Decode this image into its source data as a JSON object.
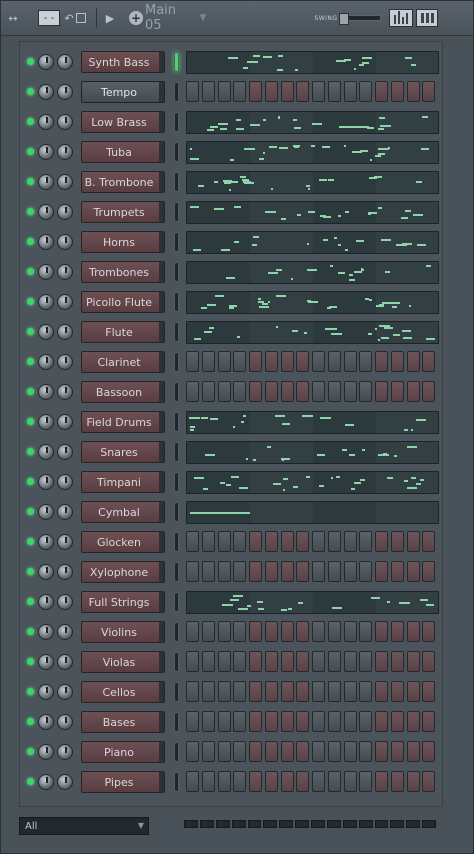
{
  "toolbar": {
    "pattern_name": "Main 05",
    "swing_label": "SWING",
    "swing_value": 0.0,
    "icons": [
      "arrows-icon",
      "minus-icon",
      "undo-icon",
      "box-icon",
      "play-icon",
      "plus-icon",
      "graph-editor-icon",
      "keyboard-editor-icon"
    ]
  },
  "colors": {
    "led_on": "#3bd36b",
    "note": "#8fd4a8",
    "step_red": "#6d5559",
    "step_gray": "#5b6368"
  },
  "channels": [
    {
      "name": "Synth Bass",
      "mode": "roll",
      "selected": true
    },
    {
      "name": "Tempo",
      "mode": "steps",
      "name_style": "gray"
    },
    {
      "name": "Low Brass",
      "mode": "roll"
    },
    {
      "name": "Tuba",
      "mode": "roll"
    },
    {
      "name": "B. Trombone",
      "mode": "roll"
    },
    {
      "name": "Trumpets",
      "mode": "roll"
    },
    {
      "name": "Horns",
      "mode": "roll"
    },
    {
      "name": "Trombones",
      "mode": "roll"
    },
    {
      "name": "Picollo Flute",
      "mode": "roll"
    },
    {
      "name": "Flute",
      "mode": "roll"
    },
    {
      "name": "Clarinet",
      "mode": "steps"
    },
    {
      "name": "Bassoon",
      "mode": "steps"
    },
    {
      "name": "Field Drums",
      "mode": "roll"
    },
    {
      "name": "Snares",
      "mode": "roll"
    },
    {
      "name": "Timpani",
      "mode": "roll"
    },
    {
      "name": "Cymbal",
      "mode": "roll"
    },
    {
      "name": "Glocken",
      "mode": "steps"
    },
    {
      "name": "Xylophone",
      "mode": "steps"
    },
    {
      "name": "Full Strings",
      "mode": "roll"
    },
    {
      "name": "Violins",
      "mode": "steps"
    },
    {
      "name": "Violas",
      "mode": "steps"
    },
    {
      "name": "Cellos",
      "mode": "steps"
    },
    {
      "name": "Bases",
      "mode": "steps"
    },
    {
      "name": "Piano",
      "mode": "steps"
    },
    {
      "name": "Pipes",
      "mode": "steps"
    }
  ],
  "footer": {
    "filter_value": "All"
  }
}
